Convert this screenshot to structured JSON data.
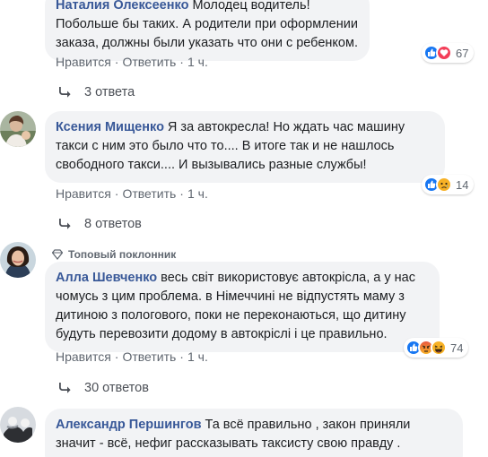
{
  "comments": [
    {
      "author": "Наталия Олексеенко",
      "text": "Молодец водитель! Побольше бы таких. А родители при оформлении заказа, должны были указать что они с ребенком.",
      "actions": {
        "like": "Нравится",
        "reply": "Ответить",
        "time": "1 ч."
      },
      "reactions": {
        "count": "67",
        "icons": [
          "like-icon",
          "love-icon"
        ]
      },
      "replies_label": "3 ответа"
    },
    {
      "author": "Ксения Мищенко",
      "text": "Я за автокресла! Но ждать час машину такси с ним это было что то.... В итоге так и не нашлось свободного такси.... И вызывались разные службы!",
      "actions": {
        "like": "Нравится",
        "reply": "Ответить",
        "time": "1 ч."
      },
      "reactions": {
        "count": "14",
        "icons": [
          "like-icon",
          "sad-icon"
        ]
      },
      "replies_label": "8 ответов"
    },
    {
      "badge": "Топовый поклонник",
      "author": "Алла Шевченко",
      "text": "весь світ використовує автокрісла, а у нас чомусь з цим проблема. в Німеччині не відпустять маму з дитиною з пологового, поки не переконаються, що дитину будуть перевозити додому в автокріслі і це правильно.",
      "actions": {
        "like": "Нравится",
        "reply": "Ответить",
        "time": "1 ч."
      },
      "reactions": {
        "count": "74",
        "icons": [
          "like-icon",
          "angry-icon",
          "haha-icon"
        ]
      },
      "replies_label": "30 ответов"
    },
    {
      "author": "Александр Першингов",
      "text": "Та всё правильно , закон приняли значит - всё, нефиг рассказывать таксисту свою правду ."
    }
  ],
  "colors": {
    "link": "#385898",
    "bubble": "#f2f3f5",
    "like": "#1877f2",
    "love": "#f33e58",
    "yellow": "#f7b125"
  }
}
